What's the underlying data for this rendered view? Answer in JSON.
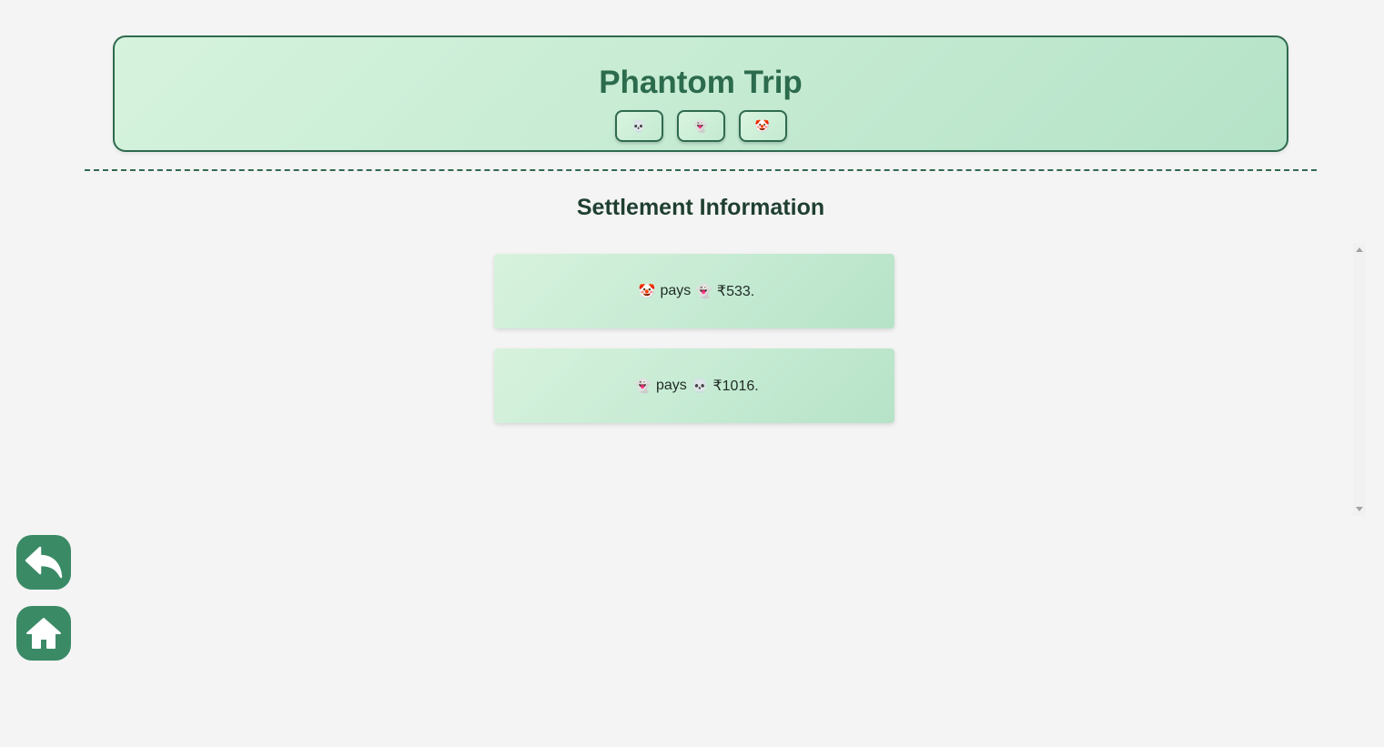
{
  "header": {
    "title": "Phantom Trip",
    "members": [
      {
        "emoji": "💀",
        "icon": "skull-icon"
      },
      {
        "emoji": "👻",
        "icon": "ghost-icon"
      },
      {
        "emoji": "🤡",
        "icon": "clown-icon"
      }
    ]
  },
  "settlement": {
    "title": "Settlement Information",
    "items": [
      {
        "from": "🤡",
        "verb": "pays",
        "to": "👻",
        "amount": "₹533."
      },
      {
        "from": "👻",
        "verb": "pays",
        "to": "💀",
        "amount": "₹1016."
      }
    ]
  },
  "nav": {
    "back_icon": "back-arrow-icon",
    "home_icon": "home-icon"
  },
  "colors": {
    "accent": "#2f6a4f",
    "fab": "#3a8a66",
    "card_start": "#d7f2dd",
    "card_end": "#b6e3c8",
    "background": "#f4f4f4"
  }
}
